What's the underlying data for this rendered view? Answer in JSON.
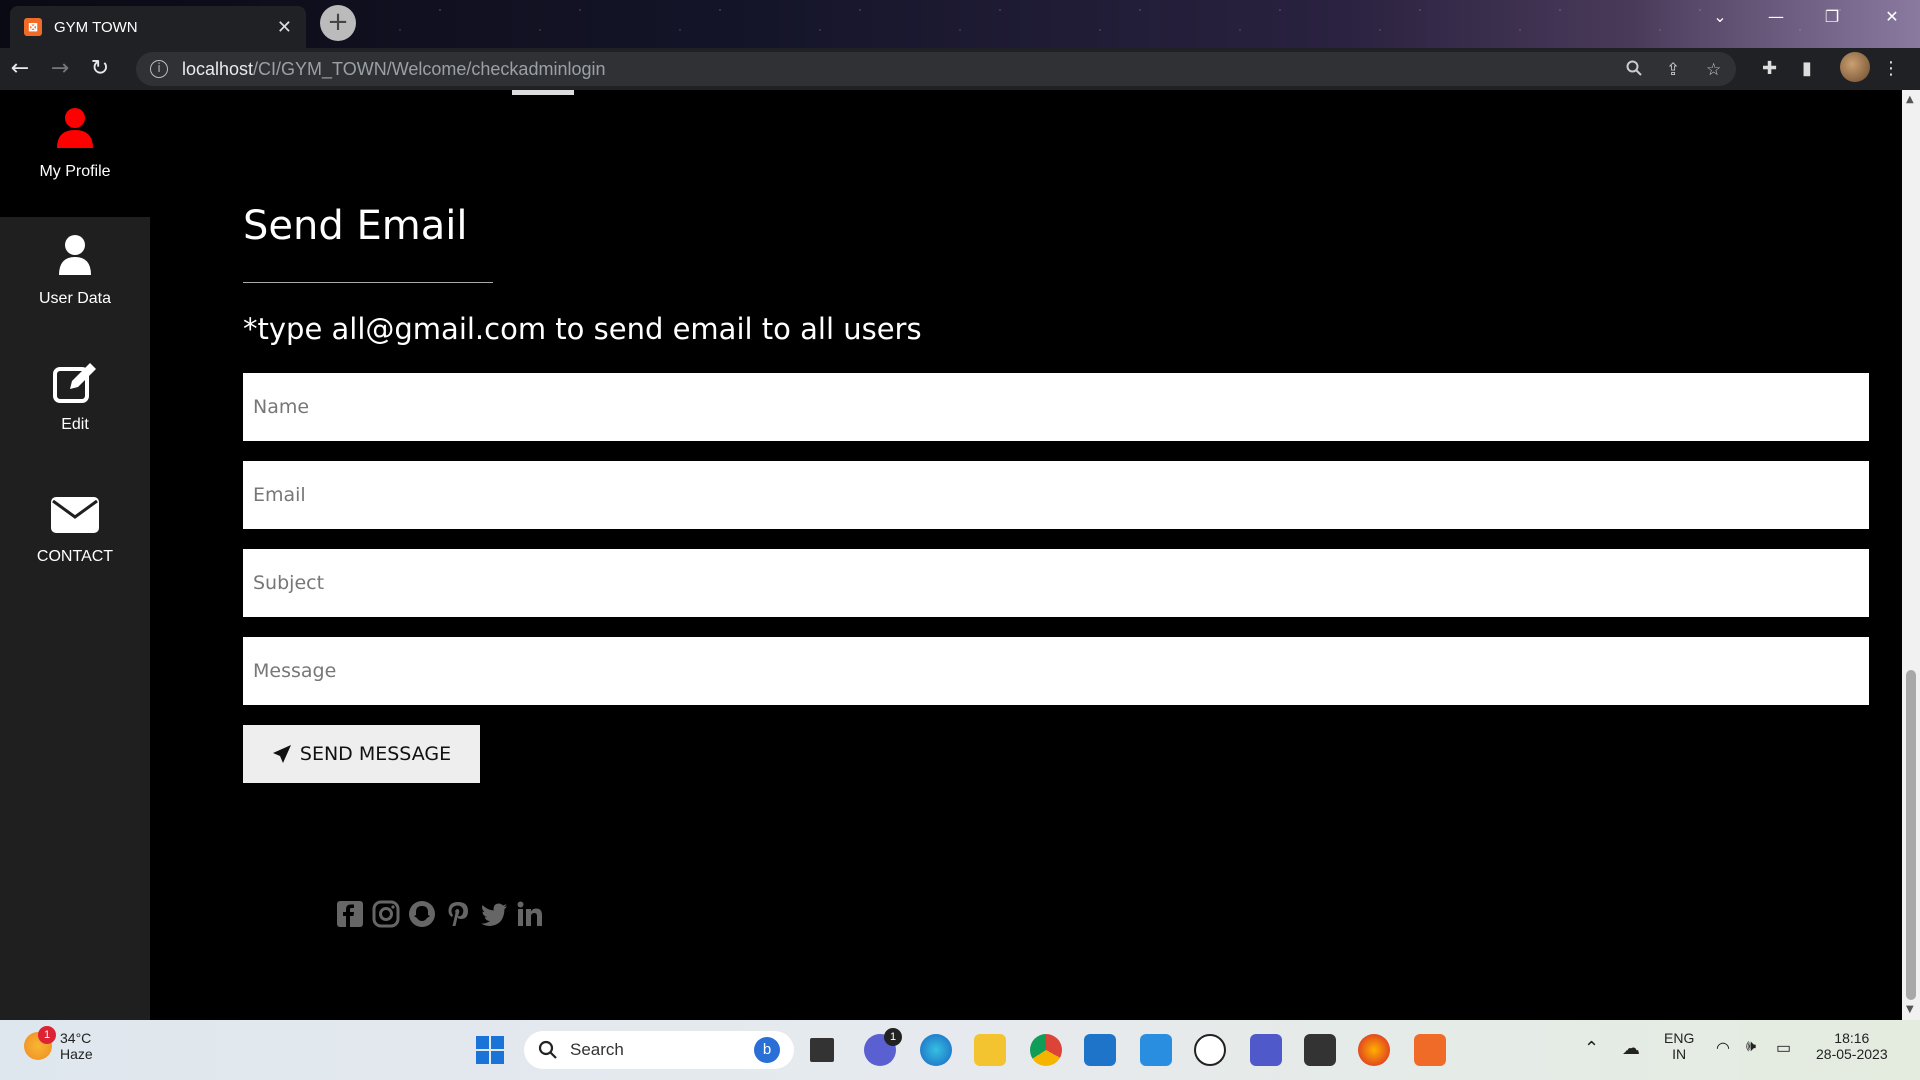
{
  "browser": {
    "tab_title": "GYM TOWN",
    "url_host": "localhost",
    "url_path": "/CI/GYM_TOWN/Welcome/checkadminlogin"
  },
  "sidebar": {
    "items": [
      {
        "label": "My Profile",
        "icon": "user-icon",
        "color": "#ff0000"
      },
      {
        "label": "User Data",
        "icon": "user-icon",
        "color": "#ffffff"
      },
      {
        "label": "Edit",
        "icon": "edit-icon",
        "color": "#ffffff"
      },
      {
        "label": "CONTACT",
        "icon": "envelope-icon",
        "color": "#ffffff"
      }
    ]
  },
  "main": {
    "title": "Send Email",
    "hint": "*type all@gmail.com to send email to all users",
    "fields": {
      "name_placeholder": "Name",
      "email_placeholder": "Email",
      "subject_placeholder": "Subject",
      "message_placeholder": "Message"
    },
    "send_label": "SEND MESSAGE",
    "social_icons": [
      "facebook-icon",
      "instagram-icon",
      "snapchat-icon",
      "pinterest-icon",
      "twitter-icon",
      "linkedin-icon"
    ]
  },
  "taskbar": {
    "weather_temp": "34°C",
    "weather_desc": "Haze",
    "weather_badge": "1",
    "search_label": "Search",
    "lang": "ENG",
    "region": "IN",
    "time": "18:16",
    "date": "28-05-2023",
    "teams_badge": "1"
  }
}
